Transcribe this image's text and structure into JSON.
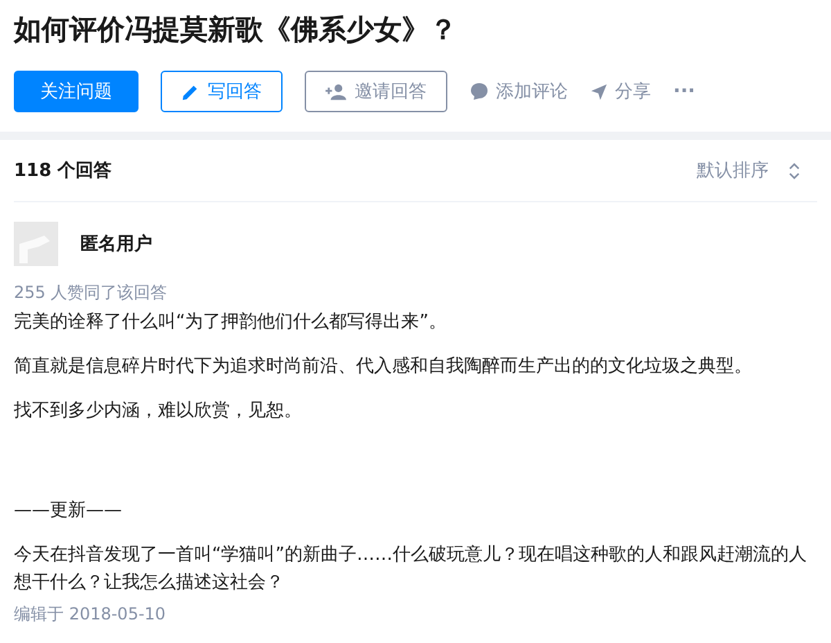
{
  "question": {
    "title": "如何评价冯提莫新歌《佛系少女》？"
  },
  "actions": [
    {
      "kind": "follow",
      "label": "关注问题"
    },
    {
      "kind": "write",
      "label": "写回答"
    },
    {
      "kind": "invite",
      "label": "邀请回答"
    },
    {
      "kind": "comment",
      "label": "添加评论"
    },
    {
      "kind": "share",
      "label": "分享"
    },
    {
      "kind": "more",
      "label": "···"
    }
  ],
  "answers_header": {
    "count": "118 个回答",
    "sort": "默认排序"
  },
  "answer": {
    "author": "匿名用户",
    "votes": "255 人赞同了该回答",
    "paragraphs": [
      {
        "kind": "text",
        "text": "完美的诠释了什么叫“为了押韵他们什么都写得出来”。"
      },
      {
        "kind": "text",
        "text": "简直就是信息碎片时代下为追求时尚前沿、代入感和自我陶醉而生产出的的文化垃圾之典型。"
      },
      {
        "kind": "text",
        "text": "找不到多少内涵，难以欣赏，见恕。"
      },
      {
        "kind": "section",
        "text": "——更新——"
      },
      {
        "kind": "text",
        "text": "今天在抖音发现了一首叫“学猫叫”的新曲子……什么破玩意儿？现在唱这种歌的人和跟风赶潮流的人想干什么？让我怎么描述这社会？"
      }
    ],
    "edited": "编辑于 2018-05-10"
  }
}
